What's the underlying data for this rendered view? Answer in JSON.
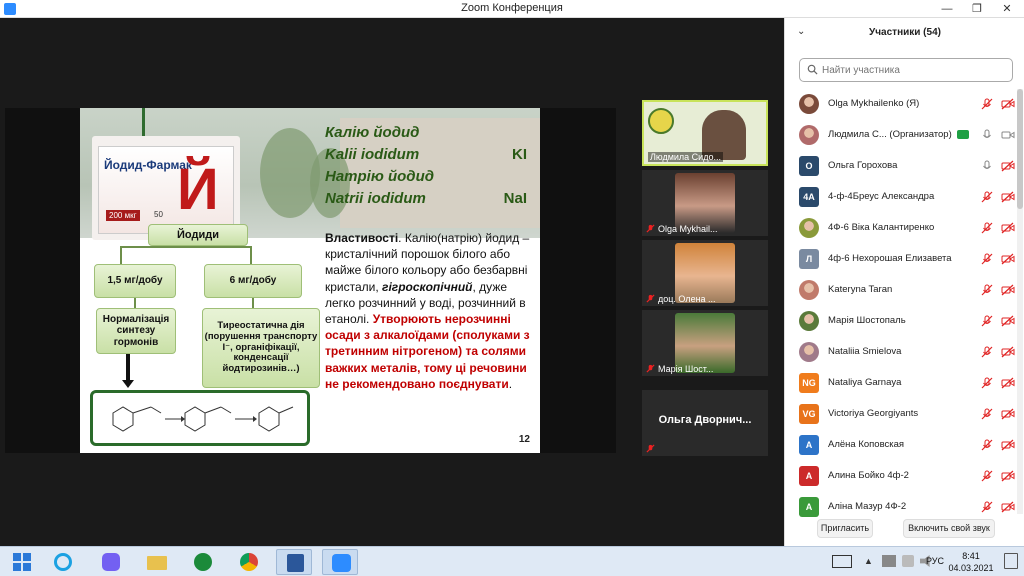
{
  "window": {
    "title": "Zoom Конференция",
    "minimize": "—",
    "restore": "❐",
    "close": "✕"
  },
  "slide": {
    "box_brand": "Йодид-Фармак",
    "box_letter": "Й",
    "box_dose": "200 мкг",
    "box_count": "50",
    "diagram": {
      "root": "Йодиди",
      "left_dose": "1,5 мг/добу",
      "right_dose": "6 мг/добу",
      "left_effect": "Нормалізація синтезу гормонів",
      "right_effect": "Тиреостатична дія (порушення транспорту I⁻, органіфікації, конденсації йодтирозинів…)"
    },
    "titles": [
      {
        "text": "Калію йодид",
        "formula": ""
      },
      {
        "text": "Kalii iodidum",
        "formula": "KI"
      },
      {
        "text": "Натрію йодид",
        "formula": ""
      },
      {
        "text": "Natrii iodidum",
        "formula": "NaI"
      }
    ],
    "props_label": "Властивості",
    "props_text1": ". Калію(натрію) йодид – кристалічний порошок білого або майже білого кольору або безбарвні кристали, ",
    "props_hygro": "гігроскопічний",
    "props_text2": ", дуже легко розчинний у воді, розчинний в етанолі. ",
    "props_red": "Утворюють нерозчинні осади з алкалоїдами (сполуками з третинним нітрогеном) та солями важких металів, тому ці речовини не рекомендовано поєднувати",
    "props_end": ".",
    "page_number": "12"
  },
  "tiles": [
    {
      "name": "Людмила Сидо...",
      "active": true
    },
    {
      "name": "Olga Mykhail...",
      "active": false
    },
    {
      "name": "доц. Олена ...",
      "active": false
    },
    {
      "name": "Марія Шост...",
      "active": false
    },
    {
      "name": "Ольга Дворнич...",
      "active": false
    }
  ],
  "participants_panel": {
    "title": "Участники (54)",
    "search_placeholder": "Найти участника",
    "participants": [
      {
        "name": "Olga Mykhailenko (Я)",
        "initials": "",
        "color": "#7a4a3a",
        "photo": true
      },
      {
        "name": "Людмила С... (Организатор)",
        "initials": "",
        "color": "#b06a6a",
        "photo": true,
        "host": true
      },
      {
        "name": "Ольга Горохова",
        "initials": "О",
        "color": "#2b4a6b"
      },
      {
        "name": "4-ф-4Бреус Александра",
        "initials": "4A",
        "color": "#2b4a6b"
      },
      {
        "name": "4Ф-6 Віка Калантиренко",
        "initials": "",
        "color": "#8a9a3a",
        "photo": true
      },
      {
        "name": "4ф-6 Нехорошая Елизавета",
        "initials": "Л",
        "color": "#7a8aa0"
      },
      {
        "name": "Kateryna Taran",
        "initials": "",
        "color": "#c07a6a",
        "photo": true
      },
      {
        "name": "Марія Шостопаль",
        "initials": "",
        "color": "#5a7a3a",
        "photo": true
      },
      {
        "name": "Nataliia Smielova",
        "initials": "",
        "color": "#a07a8a",
        "photo": true
      },
      {
        "name": "Nataliya Garnaya",
        "initials": "NG",
        "color": "#f07c1c"
      },
      {
        "name": "Victoriya Georgiyants",
        "initials": "VG",
        "color": "#e8731a"
      },
      {
        "name": "Алёна Коповская",
        "initials": "А",
        "color": "#2d74c8"
      },
      {
        "name": "Алина Бойко 4ф-2",
        "initials": "А",
        "color": "#cc2a2a"
      },
      {
        "name": "Аліна Мазур 4Ф-2",
        "initials": "А",
        "color": "#3a9a3a"
      }
    ],
    "invite_label": "Пригласить",
    "unmute_label": "Включить свой звук"
  },
  "taskbar": {
    "lang": "РУС",
    "time": "8:41",
    "date": "04.03.2021"
  }
}
